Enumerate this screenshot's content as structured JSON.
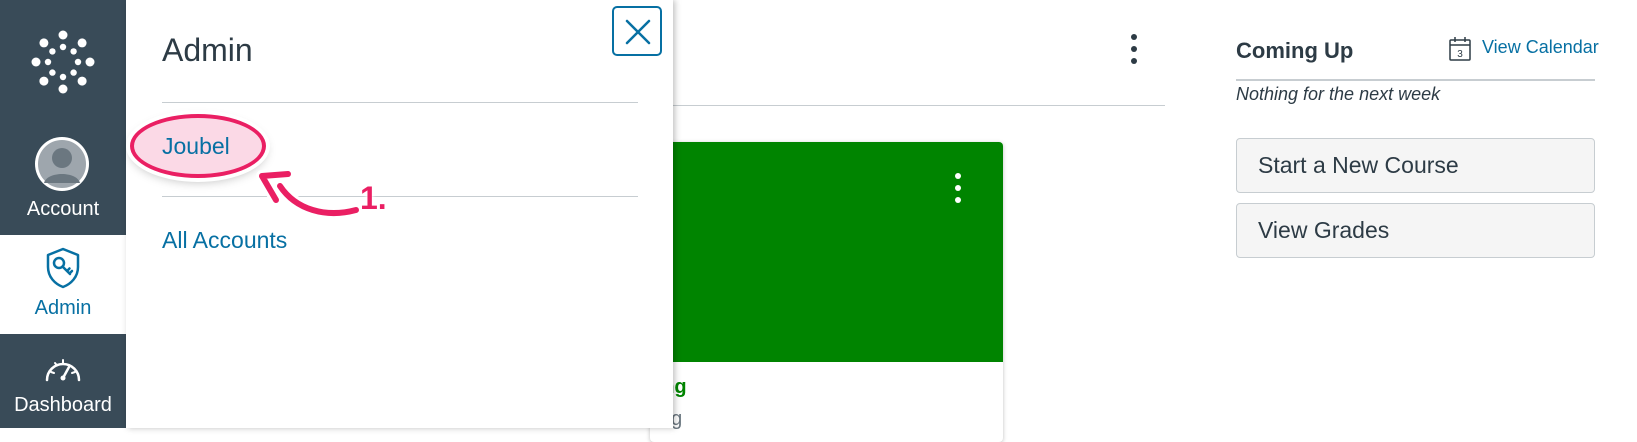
{
  "global_nav": {
    "items": [
      {
        "label": "Account",
        "icon": "avatar-icon"
      },
      {
        "label": "Admin",
        "icon": "shield-key-icon",
        "active": true
      },
      {
        "label": "Dashboard",
        "icon": "speedometer-icon"
      }
    ],
    "logo_icon": "canvas-logo-icon",
    "bg_color": "#394b58"
  },
  "tray": {
    "title": "Admin",
    "links": [
      {
        "label": "Joubel"
      },
      {
        "label": "All Accounts"
      }
    ],
    "close_icon": "close-icon",
    "annotation": {
      "label": "1.",
      "color": "#ea1f63"
    }
  },
  "course_card": {
    "name": "ting",
    "subtitle": "ting",
    "color": "#008400"
  },
  "sidebar": {
    "coming_up": "Coming Up",
    "view_calendar": "View Calendar",
    "calendar_icon_day": "3",
    "empty_text": "Nothing for the next week",
    "buttons": [
      {
        "label": "Start a New Course"
      },
      {
        "label": "View Grades"
      }
    ]
  },
  "colors": {
    "link": "#0770a3",
    "brand_green": "#008400",
    "annotation_pink": "#ea1f63"
  }
}
